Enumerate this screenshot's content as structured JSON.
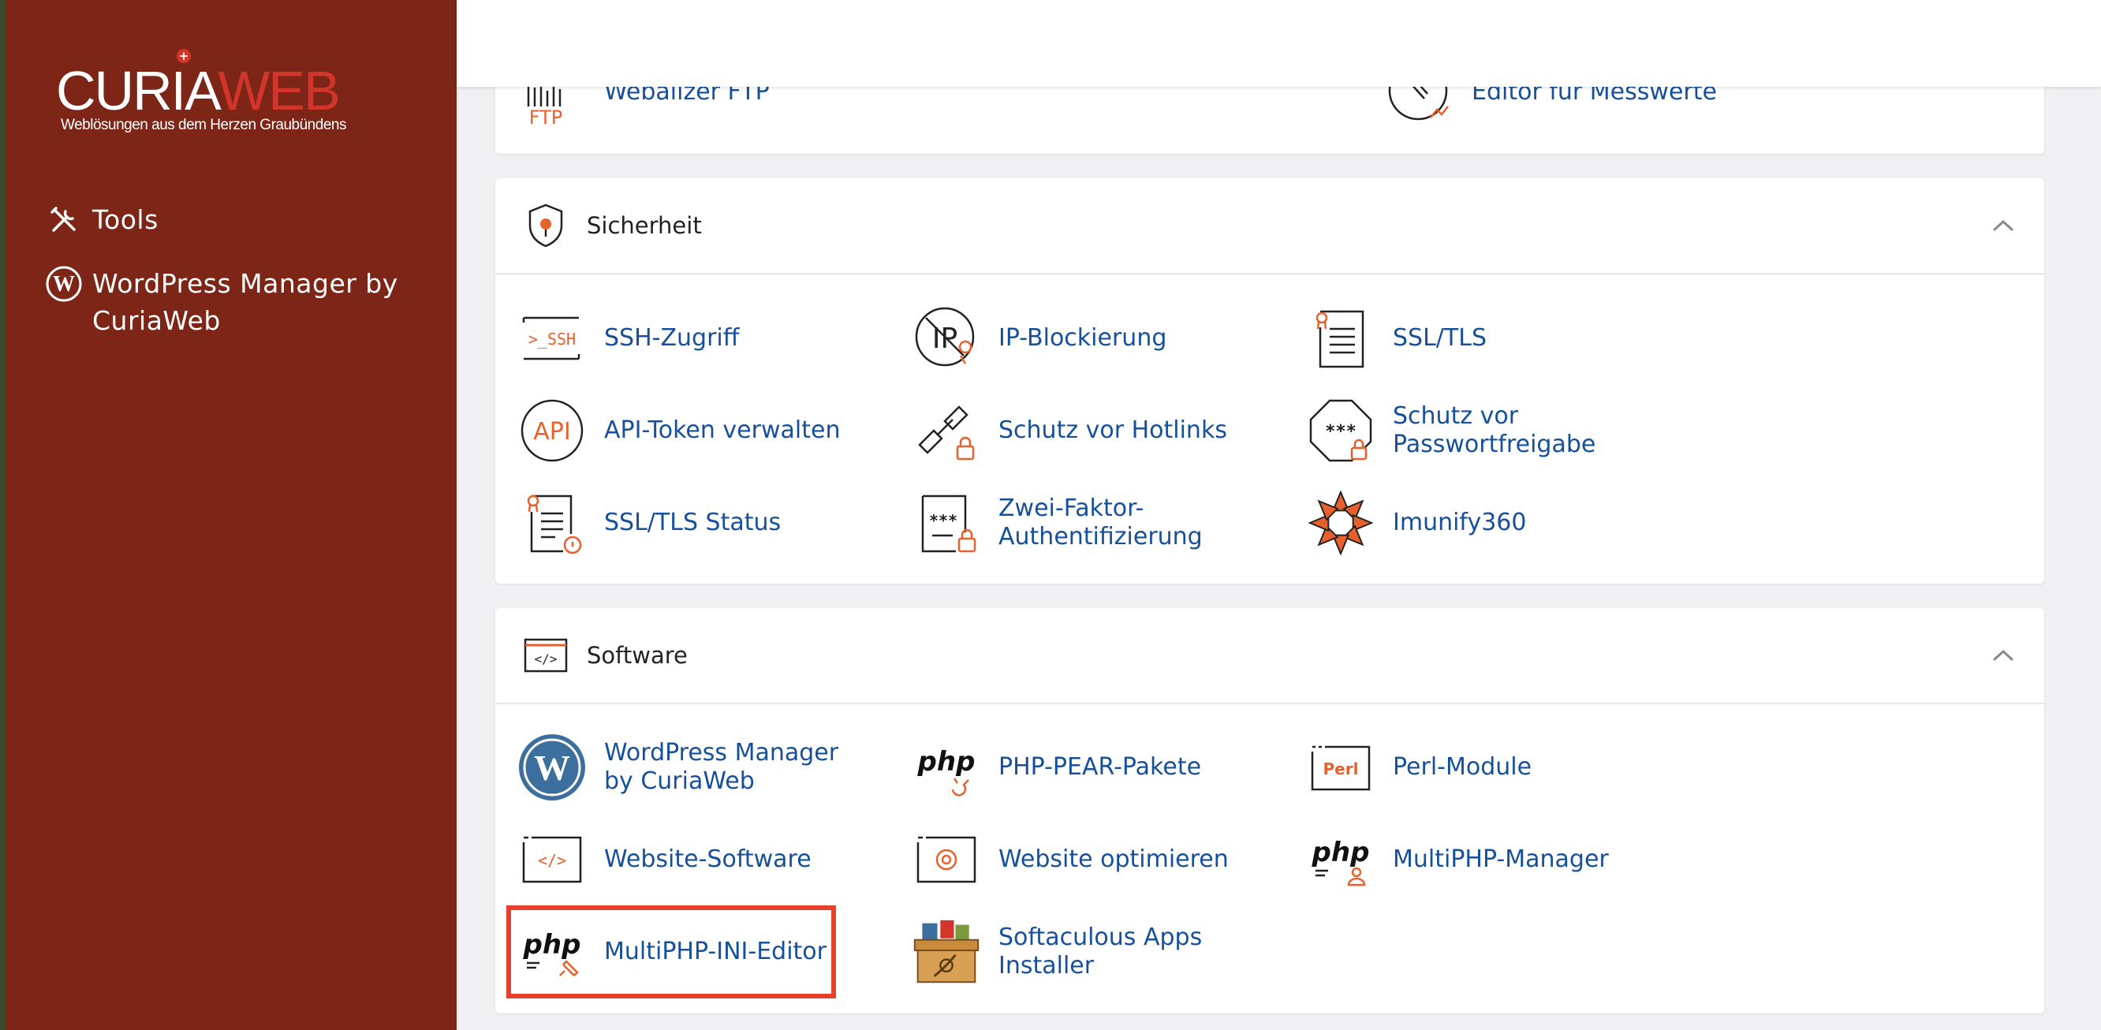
{
  "logo": {
    "part1": "CURIA",
    "part2": "WEB",
    "plus": "+",
    "tagline": "Weblösungen aus dem Herzen Graubündens"
  },
  "sidebar": {
    "items": [
      {
        "label": "Tools",
        "icon": "tools-icon"
      },
      {
        "label": "WordPress Manager by CuriaWeb",
        "icon": "wordpress-icon"
      }
    ]
  },
  "partial_row": {
    "items": [
      {
        "label": "Webalizer FTP",
        "icon": "webalizer-ftp-icon",
        "icon_text": "FTP"
      },
      {
        "label": "Editor für Messwerte",
        "icon": "metrics-editor-icon"
      }
    ]
  },
  "security": {
    "title": "Sicherheit",
    "items": [
      {
        "label": "SSH-Zugriff",
        "icon": "ssh-icon",
        "icon_text": ">_SSH"
      },
      {
        "label": "IP-Blockierung",
        "icon": "ip-blocker-icon",
        "icon_text": "IP"
      },
      {
        "label": "SSL/TLS",
        "icon": "ssl-tls-icon"
      },
      {
        "label": "API-Token verwalten",
        "icon": "api-token-icon",
        "icon_text": "API"
      },
      {
        "label": "Schutz vor Hotlinks",
        "icon": "hotlink-protection-icon"
      },
      {
        "label": "Schutz vor Passwortfreigabe",
        "icon": "password-leak-icon",
        "icon_text": "***"
      },
      {
        "label": "SSL/TLS Status",
        "icon": "ssl-status-icon"
      },
      {
        "label": "Zwei-Faktor-Authentifizierung",
        "icon": "two-factor-icon",
        "icon_text": "***"
      },
      {
        "label": "Imunify360",
        "icon": "imunify360-icon"
      }
    ]
  },
  "software": {
    "title": "Software",
    "header_icon_text": "</>",
    "items": [
      {
        "label": "WordPress Manager by CuriaWeb",
        "icon": "wordpress-logo-icon"
      },
      {
        "label": "PHP-PEAR-Pakete",
        "icon": "php-pear-icon",
        "icon_text": "php"
      },
      {
        "label": "Perl-Module",
        "icon": "perl-icon",
        "icon_text": "Perl"
      },
      {
        "label": "Website-Software",
        "icon": "website-software-icon",
        "icon_text": "</>"
      },
      {
        "label": "Website optimieren",
        "icon": "optimize-website-icon"
      },
      {
        "label": "MultiPHP-Manager",
        "icon": "multiphp-manager-icon",
        "icon_text": "php"
      },
      {
        "label": "MultiPHP-INI-Editor",
        "icon": "multiphp-ini-editor-icon",
        "icon_text": "php",
        "highlighted": true
      },
      {
        "label": "Softaculous Apps Installer",
        "icon": "softaculous-icon"
      }
    ]
  },
  "colors": {
    "sidebar": "#7d2516",
    "accent": "#e8612c",
    "link": "#17509a",
    "highlight": "#e8402e",
    "brand_red": "#d2352a"
  }
}
